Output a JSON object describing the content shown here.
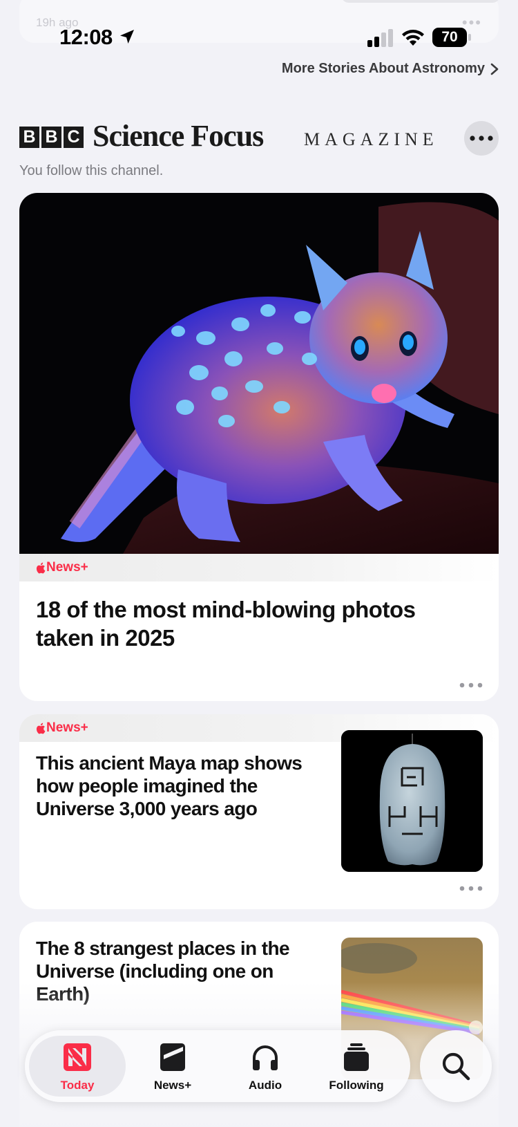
{
  "status_bar": {
    "time": "12:08",
    "battery": "70"
  },
  "previous_card": {
    "timestamp": "19h ago"
  },
  "more_stories": {
    "label": "More Stories About Astronomy"
  },
  "channel": {
    "bbc_letters": [
      "B",
      "B",
      "C"
    ],
    "name": "Science Focus",
    "subtitle": "MAGAZINE",
    "follow_text": "You follow this channel."
  },
  "stories": [
    {
      "badge": "News+",
      "headline": "18 of the most mind-blowing photos taken in 2025"
    },
    {
      "badge": "News+",
      "headline": "This ancient Maya map shows how people imagined the Universe 3,000 years ago"
    },
    {
      "headline": "The 8 strangest places in the Universe (including one on Earth)"
    }
  ],
  "tab_bar": {
    "tabs": [
      {
        "label": "Today",
        "icon": "news-today-icon",
        "active": true
      },
      {
        "label": "News+",
        "icon": "news-plus-icon",
        "active": false
      },
      {
        "label": "Audio",
        "icon": "headphones-icon",
        "active": false
      },
      {
        "label": "Following",
        "icon": "following-icon",
        "active": false
      }
    ],
    "search_icon": "search-icon"
  },
  "colors": {
    "accent": "#fa2d48",
    "background": "#f2f2f7",
    "card": "#ffffff"
  }
}
